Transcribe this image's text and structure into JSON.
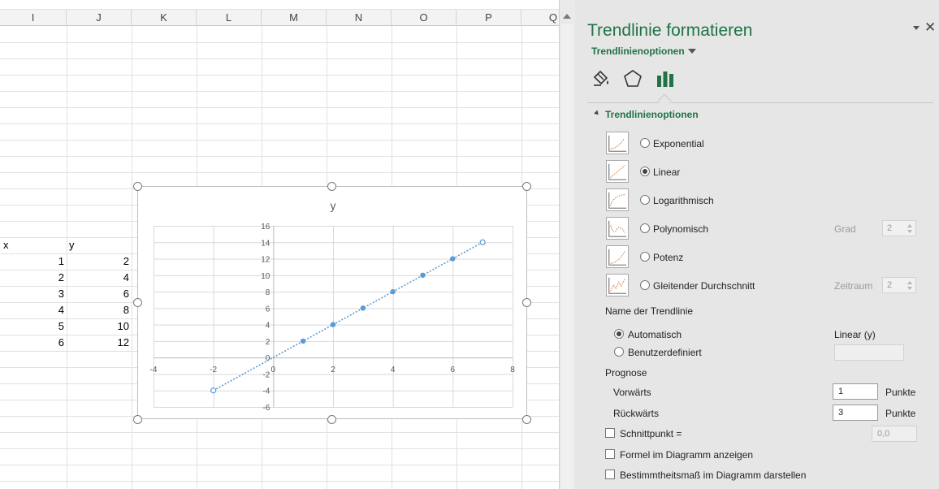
{
  "sheet": {
    "columns": [
      "I",
      "J",
      "K",
      "L",
      "M",
      "N",
      "O",
      "P",
      "Q"
    ],
    "header_x": "x",
    "header_y": "y",
    "x_values": [
      "1",
      "2",
      "3",
      "4",
      "5",
      "6"
    ],
    "y_values": [
      "2",
      "4",
      "6",
      "8",
      "10",
      "12"
    ]
  },
  "chart_data": {
    "type": "scatter",
    "title": "y",
    "xlim": [
      -4,
      8
    ],
    "ylim": [
      -6,
      16
    ],
    "x_ticks": [
      -4,
      -2,
      0,
      2,
      4,
      6,
      8
    ],
    "y_ticks": [
      -6,
      -4,
      -2,
      0,
      2,
      4,
      6,
      8,
      10,
      12,
      14,
      16
    ],
    "grid": true,
    "legend": "none",
    "series": [
      {
        "x": [
          1,
          2,
          3,
          4,
          5,
          6
        ],
        "y": [
          2,
          4,
          6,
          8,
          10,
          12
        ],
        "color": "#5b9bd5"
      }
    ],
    "trendline": {
      "type": "linear",
      "x": [
        -2,
        7
      ],
      "y": [
        -4,
        14
      ],
      "color": "#5b9bd5",
      "style": "dotted"
    }
  },
  "pane": {
    "title": "Trendlinie formatieren",
    "subtitle": "Trendlinienoptionen",
    "section_title": "Trendlinienoptionen",
    "types": [
      {
        "label": "Exponential",
        "selected": false
      },
      {
        "label": "Linear",
        "selected": true
      },
      {
        "label": "Logarithmisch",
        "selected": false
      },
      {
        "label": "Polynomisch",
        "selected": false
      },
      {
        "label": "Potenz",
        "selected": false
      },
      {
        "label": "Gleitender Durchschnitt",
        "selected": false
      }
    ],
    "grad_label": "Grad",
    "grad_value": "2",
    "zeitraum_label": "Zeitraum",
    "zeitraum_value": "2",
    "name_heading": "Name der Trendlinie",
    "name_auto": "Automatisch",
    "name_auto_value": "Linear (y)",
    "name_custom": "Benutzerdefiniert",
    "prognose_heading": "Prognose",
    "vorwaerts_label": "Vorwärts",
    "vorwaerts_value": "1",
    "rueckwaerts_label": "Rückwärts",
    "rueckwaerts_value": "3",
    "punkte_label": "Punkte",
    "schnittpunkt_label": "Schnittpunkt =",
    "schnittpunkt_value": "0,0",
    "formel_label": "Formel im Diagramm anzeigen",
    "bestimmtheit_label": "Bestimmtheitsmaß im Diagramm darstellen"
  },
  "colors": {
    "accent": "#217346",
    "series": "#5b9bd5",
    "trend_icon": "#e07b39"
  }
}
